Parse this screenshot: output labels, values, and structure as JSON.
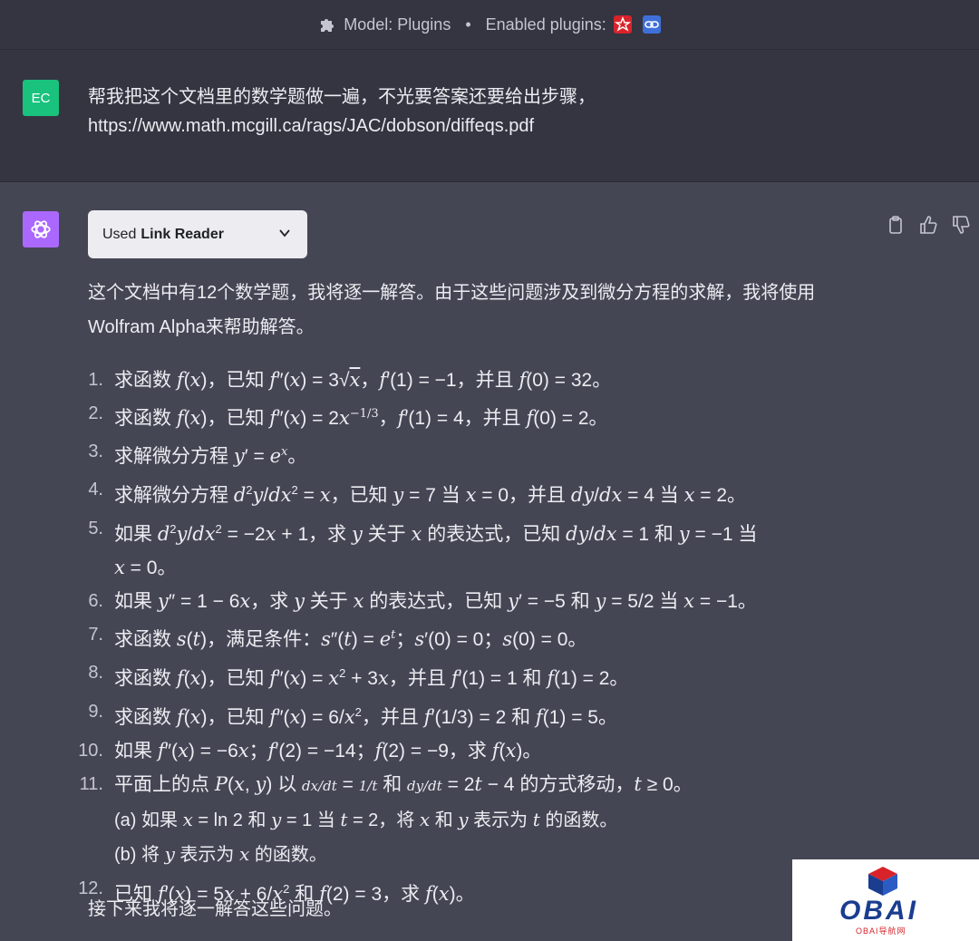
{
  "header": {
    "model_label": "Model: Plugins",
    "separator": "•",
    "plugins_label": "Enabled plugins:",
    "plugin_icons": [
      "wolfram-alpha-icon",
      "link-reader-icon"
    ],
    "colors": {
      "wolfram": "#d8232a",
      "link_reader": "#3f6fd8"
    }
  },
  "user": {
    "avatar_initials": "EC",
    "avatar_color": "#19c37d",
    "message_line1": "帮我把这个文档里的数学题做一遍，不光要答案还要给出步骤，",
    "message_line2": "https://www.math.mcgill.ca/rags/JAC/dobson/diffeqs.pdf"
  },
  "assistant": {
    "avatar_color": "#ab68ff",
    "plugin_used_prefix": "Used",
    "plugin_used_name": "Link Reader",
    "intro_line1": "这个文档中有12个数学题，我将逐一解答。由于这些问题涉及到微分方程的求解，我将使用",
    "intro_line2": "Wolfram Alpha来帮助解答。",
    "outro": "接下来我将逐一解答这些问题。",
    "questions": [
      {
        "num": "1."
      },
      {
        "num": "2."
      },
      {
        "num": "3."
      },
      {
        "num": "4."
      },
      {
        "num": "5."
      },
      {
        "num": "6."
      },
      {
        "num": "7."
      },
      {
        "num": "8."
      },
      {
        "num": "9."
      },
      {
        "num": "10."
      },
      {
        "num": "11."
      },
      {
        "num": "12."
      }
    ]
  },
  "watermark": {
    "brand": "OBAI",
    "sub": "OBAI导航网"
  }
}
